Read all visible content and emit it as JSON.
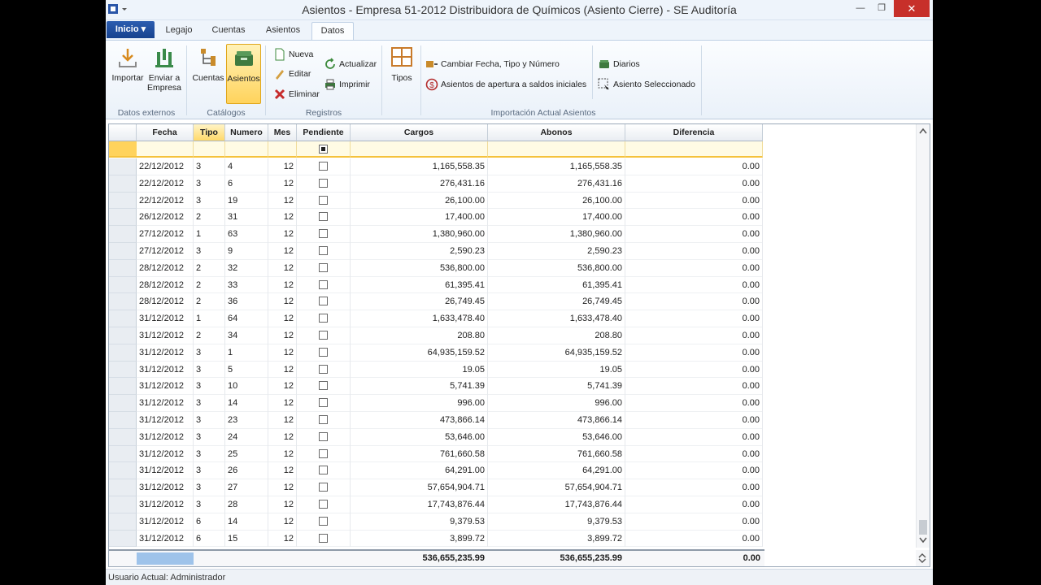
{
  "window": {
    "title": "Asientos - Empresa 51-2012 Distribuidora de Químicos (Asiento Cierre) - SE Auditoría",
    "controls": [
      "minimize",
      "restore",
      "close"
    ],
    "close_glyph": "✕",
    "minimize_glyph": "—",
    "restore_glyph": "❐"
  },
  "tabs": [
    {
      "label": "Inicio ▾",
      "active": false,
      "style": "app-menu"
    },
    {
      "label": "Legajo"
    },
    {
      "label": "Cuentas"
    },
    {
      "label": "Asientos"
    },
    {
      "label": "Datos",
      "active": true
    }
  ],
  "ribbon": {
    "groups": [
      {
        "label": "Datos externos",
        "buttons": [
          {
            "label": "Importar",
            "icon": "download-icon"
          },
          {
            "label": "Enviar a Empresa",
            "icon": "send-to-company-icon"
          }
        ]
      },
      {
        "label": "Catálogos",
        "buttons": [
          {
            "label": "Cuentas",
            "icon": "accounts-tree-icon"
          },
          {
            "label": "Asientos",
            "icon": "journal-box-icon",
            "selected": true
          }
        ]
      },
      {
        "label": "Registros",
        "buttons": [
          {
            "label": "Nueva",
            "icon": "new-page-icon"
          },
          {
            "label": "Editar",
            "icon": "pencil-icon"
          },
          {
            "label": "Eliminar",
            "icon": "delete-x-icon"
          },
          {
            "label": "Actualizar",
            "icon": "refresh-icon"
          },
          {
            "label": "Imprimir",
            "icon": "printer-icon"
          }
        ]
      },
      {
        "label": "",
        "buttons": [
          {
            "label": "Tipos",
            "icon": "grid-window-icon"
          }
        ]
      },
      {
        "label": "Importación Actual Asientos",
        "buttons": [
          {
            "label": "Cambiar Fecha, Tipo y Número",
            "icon": "change-data-icon"
          },
          {
            "label": "Asientos de apertura a saldos iniciales",
            "icon": "dollar-circle-icon"
          },
          {
            "label": "Diarios",
            "icon": "journal-icon"
          },
          {
            "label": "Asiento Seleccionado",
            "icon": "selection-cursor-icon"
          }
        ]
      }
    ]
  },
  "grid": {
    "columns": [
      "Fecha",
      "Tipo",
      "Numero",
      "Mes",
      "Pendiente",
      "Cargos",
      "Abonos",
      "Diferencia"
    ],
    "sorted_column": "Tipo",
    "rows": [
      [
        "22/12/2012",
        "3",
        "4",
        "12",
        false,
        "1,165,558.35",
        "1,165,558.35",
        "0.00"
      ],
      [
        "22/12/2012",
        "3",
        "6",
        "12",
        false,
        "276,431.16",
        "276,431.16",
        "0.00"
      ],
      [
        "22/12/2012",
        "3",
        "19",
        "12",
        false,
        "26,100.00",
        "26,100.00",
        "0.00"
      ],
      [
        "26/12/2012",
        "2",
        "31",
        "12",
        false,
        "17,400.00",
        "17,400.00",
        "0.00"
      ],
      [
        "27/12/2012",
        "1",
        "63",
        "12",
        false,
        "1,380,960.00",
        "1,380,960.00",
        "0.00"
      ],
      [
        "27/12/2012",
        "3",
        "9",
        "12",
        false,
        "2,590.23",
        "2,590.23",
        "0.00"
      ],
      [
        "28/12/2012",
        "2",
        "32",
        "12",
        false,
        "536,800.00",
        "536,800.00",
        "0.00"
      ],
      [
        "28/12/2012",
        "2",
        "33",
        "12",
        false,
        "61,395.41",
        "61,395.41",
        "0.00"
      ],
      [
        "28/12/2012",
        "2",
        "36",
        "12",
        false,
        "26,749.45",
        "26,749.45",
        "0.00"
      ],
      [
        "31/12/2012",
        "1",
        "64",
        "12",
        false,
        "1,633,478.40",
        "1,633,478.40",
        "0.00"
      ],
      [
        "31/12/2012",
        "2",
        "34",
        "12",
        false,
        "208.80",
        "208.80",
        "0.00"
      ],
      [
        "31/12/2012",
        "3",
        "1",
        "12",
        false,
        "64,935,159.52",
        "64,935,159.52",
        "0.00"
      ],
      [
        "31/12/2012",
        "3",
        "5",
        "12",
        false,
        "19.05",
        "19.05",
        "0.00"
      ],
      [
        "31/12/2012",
        "3",
        "10",
        "12",
        false,
        "5,741.39",
        "5,741.39",
        "0.00"
      ],
      [
        "31/12/2012",
        "3",
        "14",
        "12",
        false,
        "996.00",
        "996.00",
        "0.00"
      ],
      [
        "31/12/2012",
        "3",
        "23",
        "12",
        false,
        "473,866.14",
        "473,866.14",
        "0.00"
      ],
      [
        "31/12/2012",
        "3",
        "24",
        "12",
        false,
        "53,646.00",
        "53,646.00",
        "0.00"
      ],
      [
        "31/12/2012",
        "3",
        "25",
        "12",
        false,
        "761,660.58",
        "761,660.58",
        "0.00"
      ],
      [
        "31/12/2012",
        "3",
        "26",
        "12",
        false,
        "64,291.00",
        "64,291.00",
        "0.00"
      ],
      [
        "31/12/2012",
        "3",
        "27",
        "12",
        false,
        "57,654,904.71",
        "57,654,904.71",
        "0.00"
      ],
      [
        "31/12/2012",
        "3",
        "28",
        "12",
        false,
        "17,743,876.44",
        "17,743,876.44",
        "0.00"
      ],
      [
        "31/12/2012",
        "6",
        "14",
        "12",
        false,
        "9,379.53",
        "9,379.53",
        "0.00"
      ],
      [
        "31/12/2012",
        "6",
        "15",
        "12",
        false,
        "3,899.72",
        "3,899.72",
        "0.00"
      ]
    ],
    "totals": {
      "cargos": "536,655,235.99",
      "abonos": "536,655,235.99",
      "diferencia": "0.00"
    }
  },
  "status": {
    "text": "Usuario Actual: Administrador"
  },
  "colors": {
    "accent": "#ffd35c",
    "app_menu": "#1f4f9f",
    "close": "#c7302a"
  }
}
